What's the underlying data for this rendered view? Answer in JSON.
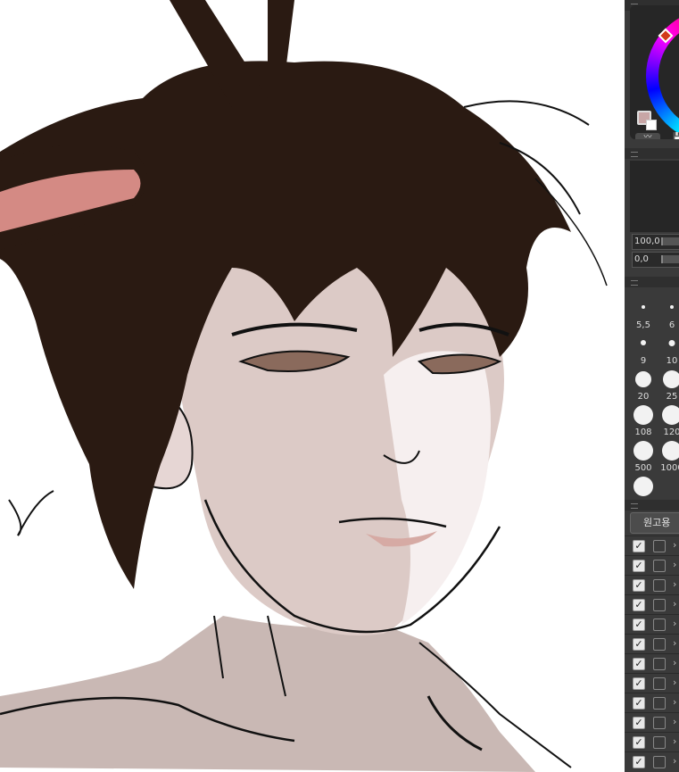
{
  "color_panel": {
    "main_color": "#c8a6a6",
    "sub_color": "#ffffff",
    "wave_label": "〰",
    "save_label": "💾"
  },
  "opacity_fields": [
    {
      "value": "100,0"
    },
    {
      "value": "0,0"
    }
  ],
  "brush_sizes": [
    {
      "label": "5,5"
    },
    {
      "label": "6"
    },
    {
      "label": "9"
    },
    {
      "label": "10"
    },
    {
      "label": "20"
    },
    {
      "label": "25"
    },
    {
      "label": "108"
    },
    {
      "label": "120"
    },
    {
      "label": "500"
    },
    {
      "label": "1000"
    },
    {
      "label": ""
    }
  ],
  "layers": {
    "folder_label": "원고용",
    "rows": [
      {
        "checked": "✓"
      },
      {
        "checked": "✓"
      },
      {
        "checked": "✓"
      },
      {
        "checked": "✓"
      },
      {
        "checked": "✓"
      },
      {
        "checked": "✓"
      },
      {
        "checked": "✓"
      },
      {
        "checked": "✓"
      },
      {
        "checked": "✓"
      },
      {
        "checked": "✓"
      },
      {
        "checked": "✓"
      },
      {
        "checked": "✓"
      }
    ],
    "row_arrow": "›"
  }
}
